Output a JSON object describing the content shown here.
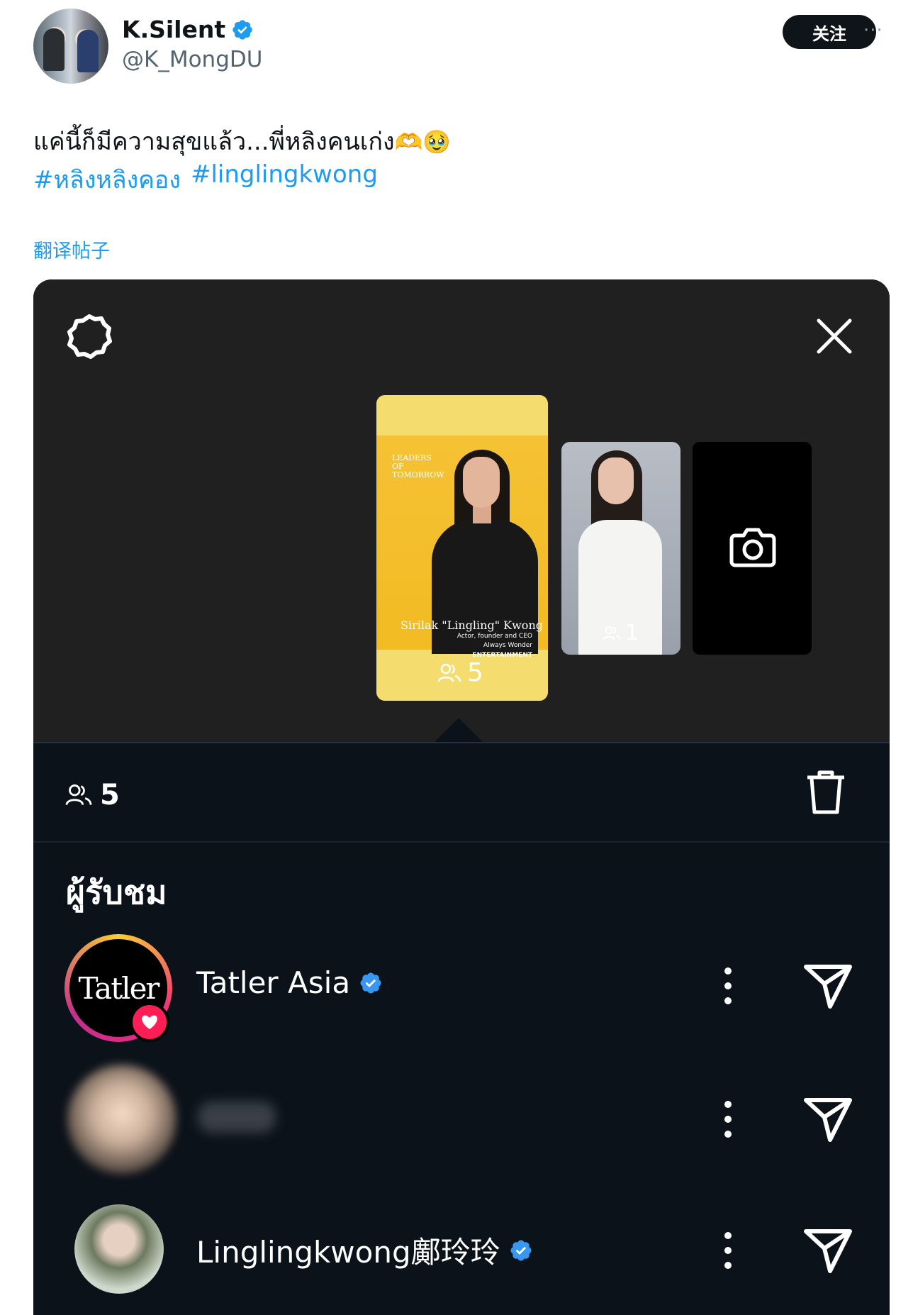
{
  "tweet": {
    "display_name": "K.Silent",
    "handle": "@K_MongDU",
    "follow_label": "关注",
    "more_label": "···",
    "text": "แค่นี้ก็มีความสุขแล้ว...พี่หลิงคนเก่ง",
    "text_emoji": "🫶🥹",
    "hashtags": [
      "#หลิงหลิงคอง",
      "#linglingkwong"
    ],
    "translate_label": "翻译帖子"
  },
  "story": {
    "main_card": {
      "headline": "LEADERS OF TOMORROW",
      "caption_name": "Sirilak \"Lingling\" Kwong",
      "caption_role": "Actor, founder and CEO",
      "caption_company": "Always Wonder",
      "caption_category": "ENTERTAINMENT",
      "viewers": "5"
    },
    "second_card": {
      "viewers": "1"
    }
  },
  "panel": {
    "viewer_total": "5",
    "section_title": "ผู้รับชม",
    "viewers": [
      {
        "name": "Tatler Asia",
        "avatar_text": "Tatler",
        "verified": true
      },
      {
        "name": "",
        "verified": false
      },
      {
        "name": "Linglingkwong鄺玲玲",
        "verified": true
      }
    ]
  },
  "colors": {
    "accent": "#1d9bf0",
    "panel_bg": "#0c121a",
    "story_bg": "#202020",
    "card_yellow": "#f2bb22"
  },
  "icons": [
    "verified-badge-icon",
    "settings-icon",
    "close-icon",
    "camera-icon",
    "people-icon",
    "trash-icon",
    "more-vertical-icon",
    "send-icon",
    "heart-icon"
  ]
}
